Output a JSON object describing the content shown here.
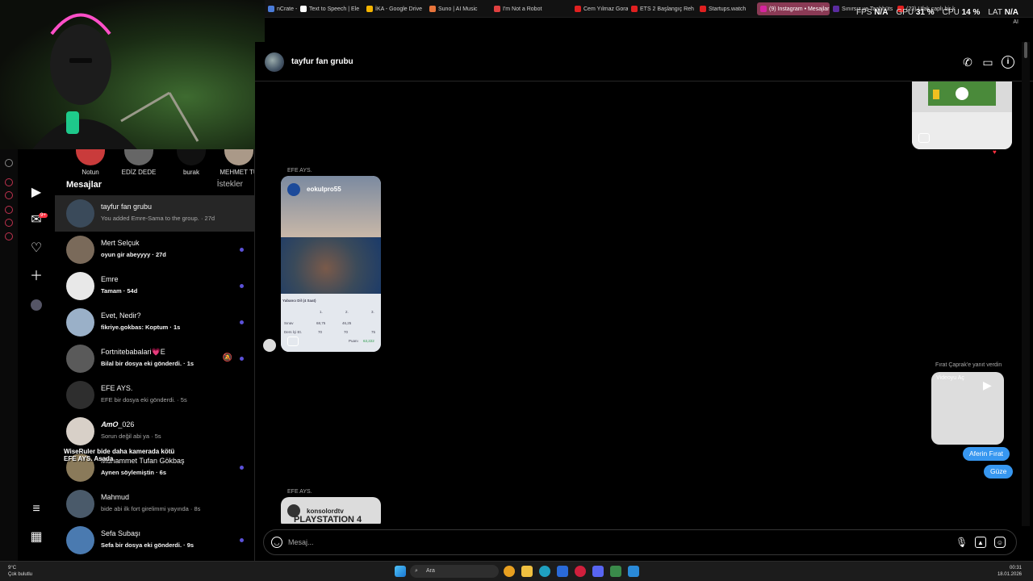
{
  "browser": {
    "tabs": [
      {
        "label": "nCrate - M",
        "color": "#4a7bd8"
      },
      {
        "label": "Text to Speech | Ele",
        "color": "#ffffff"
      },
      {
        "label": "İKA - Google Drive",
        "color": "#f4b400"
      },
      {
        "label": "Suno | AI Music",
        "color": "#e8743b"
      },
      {
        "label": "I'm Not a Robot",
        "color": "#e04040"
      },
      {
        "label": "Cem Yılmaz Gora/Ar",
        "color": "#e02020"
      },
      {
        "label": "ETS 2 Başlangıç Reh",
        "color": "#e02020"
      },
      {
        "label": "Startups.watch",
        "color": "#e02020"
      },
      {
        "label": "(9) Instagram • Mesajlar",
        "color": "#d6249f",
        "active": true
      },
      {
        "label": "Sınırsız ve Taahhüts",
        "color": "#5a2ca0"
      },
      {
        "label": "(23) Ufak çaplı bir k",
        "color": "#e02020"
      }
    ],
    "hud": {
      "fps_label": "FPS",
      "fps_value": "N/A",
      "gpu_label": "GPU",
      "gpu_value": "31 %",
      "cpu_label": "CPU",
      "cpu_value": "14 %",
      "lat_label": "LAT",
      "lat_value": "N/A"
    },
    "ai_label": "AI"
  },
  "stories": [
    {
      "label": "Notun"
    },
    {
      "label": "EDİZ DEDE"
    },
    {
      "label": "burak"
    },
    {
      "label": "MEHMET TU"
    }
  ],
  "list": {
    "heading": "Mesajlar",
    "requests": "İstekler",
    "conversations": [
      {
        "name": "tayfur fan grubu",
        "preview": "You added Emre-Sama to the group. · 27d",
        "unread": false,
        "active": true,
        "avatar": "#3a4a5a"
      },
      {
        "name": "Mert Selçuk",
        "preview": "oyun gir abeyyyy · 27d",
        "unread": true,
        "avatar": "#7a6a5a"
      },
      {
        "name": "Emre",
        "preview": "Tamam · 54d",
        "unread": true,
        "avatar": "#e8e8e8"
      },
      {
        "name": "Evet, Nedir?",
        "preview": "fikriye.gokbas: Koptum · 1s",
        "unread": true,
        "avatar": "#9ab0c8"
      },
      {
        "name": "Fortnitebabalari💗E",
        "preview": "Bilal bir dosya eki gönderdi. · 1s",
        "unread": true,
        "muted": true,
        "avatar": "#5a5a5a"
      },
      {
        "name": "EFE AYS.",
        "preview": "EFE bir dosya eki gönderdi. · 5s",
        "unread": false,
        "avatar": "#2e2e2e"
      },
      {
        "name": "𝑨𝒎𝑶_026",
        "preview": "Sorun değil abi ya · 5s",
        "unread": false,
        "avatar": "#d8d0c8"
      },
      {
        "name": "Muhammet Tufan Gökbaş",
        "preview": "Aynen söylemiştin · 6s",
        "unread": true,
        "avatar": "#8a7a5a"
      },
      {
        "name": "Mahmud",
        "preview": "bide abi ilk fort girelimmi yayında · 8s",
        "unread": false,
        "avatar": "#4a5a6a"
      },
      {
        "name": "Sefa Subaşı",
        "preview": "Sefa bir dosya eki gönderdi. · 9s",
        "unread": true,
        "avatar": "#4a7ab0"
      }
    ],
    "overlay_line1": "WiseRuler  bide daha kamerada kötü",
    "overlay_line2": "EFE AYS.  Asada"
  },
  "chat": {
    "title": "tayfur fan grubu",
    "messages": {
      "sender1": "EFE AYS.",
      "reel1_account": "eokulpro55",
      "reel1_table_title": "Yabancı Dil (4 Saat)",
      "reel1_cols": [
        "1.",
        "2.",
        "3."
      ],
      "reel1_row1_label": "Sınav",
      "reel1_row1": [
        "68,75",
        "46,25",
        ""
      ],
      "reel1_row2_label": "Ders İçi Et.",
      "reel1_row2": [
        "70",
        "70",
        "75"
      ],
      "reel1_puan_label": "Puanı",
      "reel1_puan": "63,222",
      "reply_note": "Fırat Çaprak'e yanıt verdin",
      "video_alt": "Videoyu Aç",
      "bubble1": "Aferin Fırat",
      "bubble2": "Güze",
      "sender2": "EFE AYS.",
      "reel2_account": "konsolordtv",
      "reel2_caption": "PLAYSTATION 4"
    },
    "composer_placeholder": "Mesaj..."
  },
  "nav": {
    "badge": "9+"
  },
  "taskbar": {
    "search_placeholder": "Ara",
    "weather_temp": "9°C",
    "weather_desc": "Çok bulutlu",
    "time": "00:31",
    "date": "18.01.2026"
  },
  "colors": {
    "accent_blue": "#3797f0",
    "unread_dot": "#5b51d8",
    "opera_red": "#c0324f"
  }
}
